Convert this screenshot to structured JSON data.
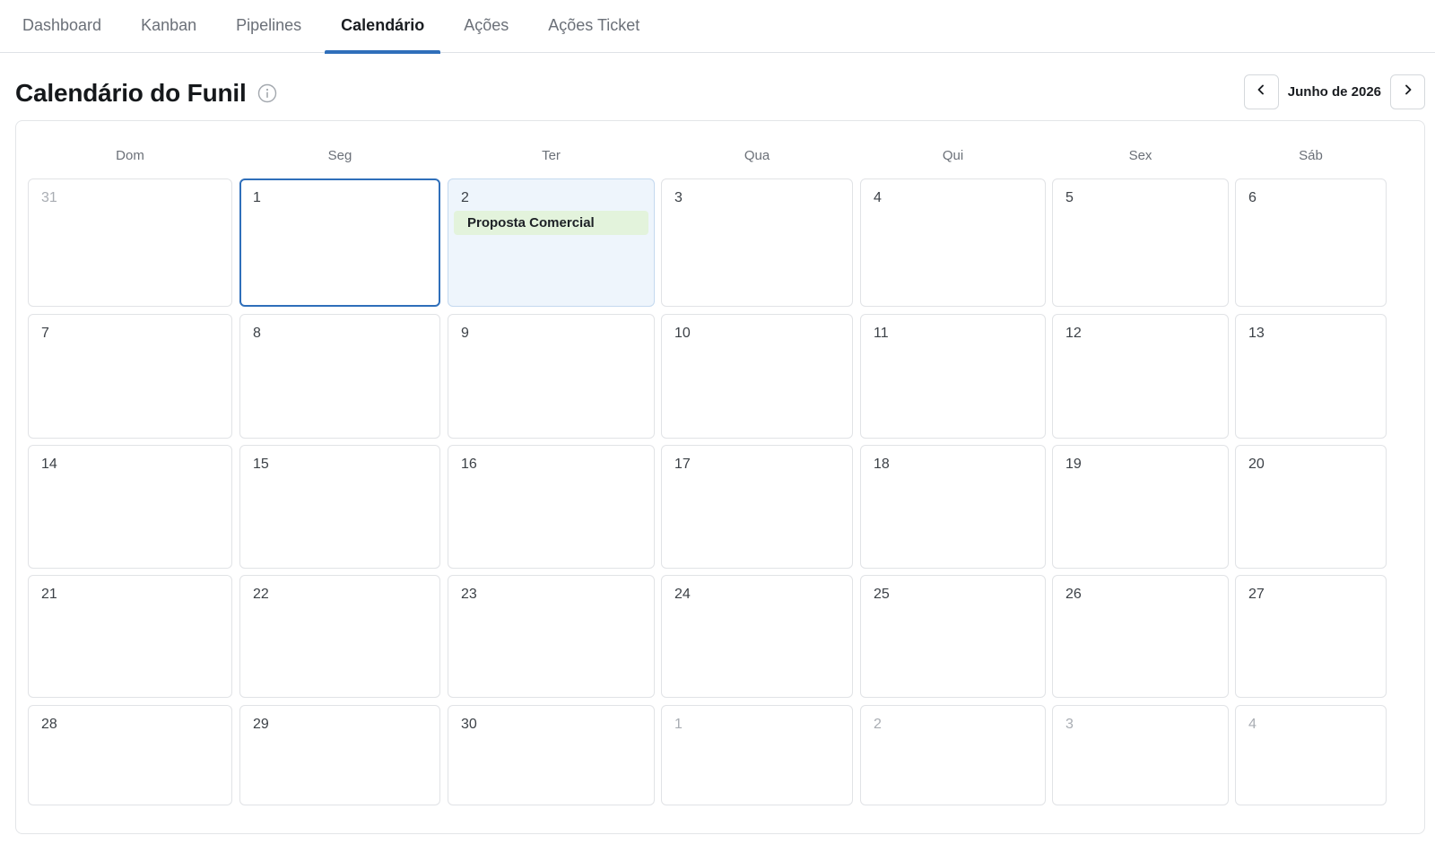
{
  "tabs": [
    {
      "label": "Dashboard",
      "active": false
    },
    {
      "label": "Kanban",
      "active": false
    },
    {
      "label": "Pipelines",
      "active": false
    },
    {
      "label": "Calendário",
      "active": true
    },
    {
      "label": "Ações",
      "active": false
    },
    {
      "label": "Ações Ticket",
      "active": false
    }
  ],
  "header": {
    "title": "Calendário do Funil",
    "info_icon": "info-circle-icon"
  },
  "month_nav": {
    "prev_icon": "chevron-left-icon",
    "label": "Junho de 2026",
    "next_icon": "chevron-right-icon"
  },
  "calendar": {
    "weekdays": [
      "Dom",
      "Seg",
      "Ter",
      "Qua",
      "Qui",
      "Sex",
      "Sáb"
    ],
    "weeks": [
      [
        {
          "day": "31",
          "muted": true
        },
        {
          "day": "1",
          "today": true
        },
        {
          "day": "2",
          "selected": true,
          "events": [
            "Proposta Comercial"
          ]
        },
        {
          "day": "3"
        },
        {
          "day": "4"
        },
        {
          "day": "5"
        },
        {
          "day": "6"
        }
      ],
      [
        {
          "day": "7"
        },
        {
          "day": "8"
        },
        {
          "day": "9"
        },
        {
          "day": "10"
        },
        {
          "day": "11"
        },
        {
          "day": "12"
        },
        {
          "day": "13"
        }
      ],
      [
        {
          "day": "14"
        },
        {
          "day": "15"
        },
        {
          "day": "16"
        },
        {
          "day": "17"
        },
        {
          "day": "18"
        },
        {
          "day": "19"
        },
        {
          "day": "20"
        }
      ],
      [
        {
          "day": "21"
        },
        {
          "day": "22"
        },
        {
          "day": "23"
        },
        {
          "day": "24"
        },
        {
          "day": "25"
        },
        {
          "day": "26"
        },
        {
          "day": "27"
        }
      ],
      [
        {
          "day": "28"
        },
        {
          "day": "29"
        },
        {
          "day": "30"
        },
        {
          "day": "1",
          "muted": true
        },
        {
          "day": "2",
          "muted": true
        },
        {
          "day": "3",
          "muted": true
        },
        {
          "day": "4",
          "muted": true
        }
      ]
    ]
  },
  "colors": {
    "accent": "#2f6fba",
    "event_bg": "#e3f3dc",
    "selected_bg": "#eef5fc"
  }
}
